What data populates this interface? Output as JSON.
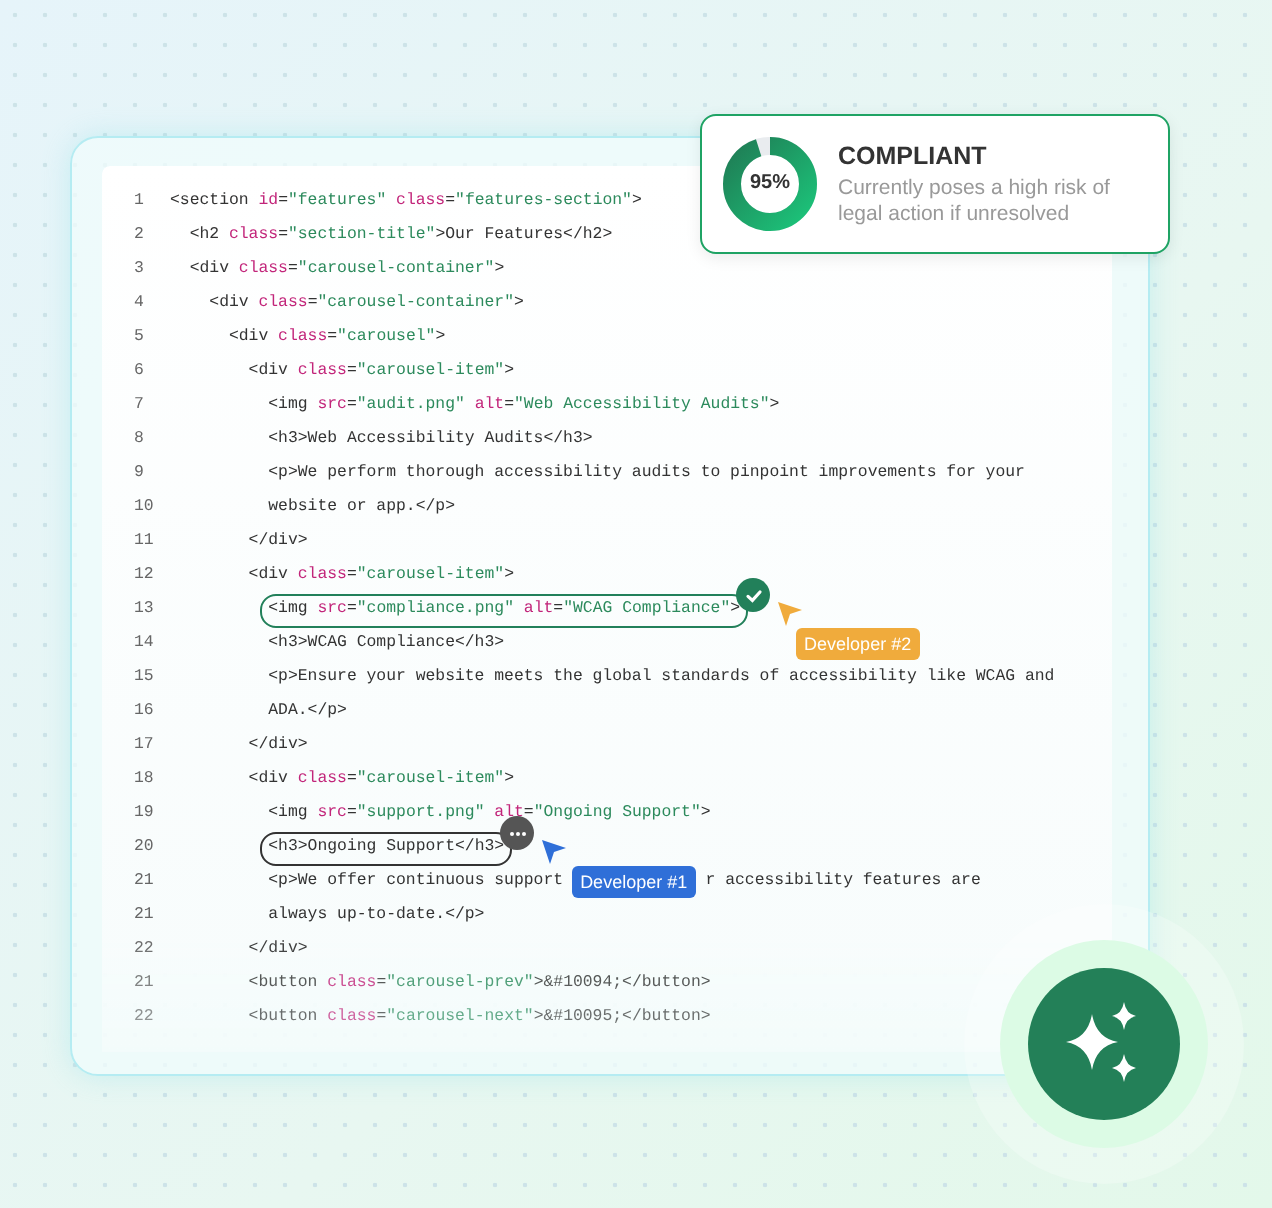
{
  "status_card": {
    "level": 0.95,
    "percent": "95%",
    "title": "COMPLIANT",
    "description": "Currently poses a high risk of legal action if unresolved"
  },
  "code_lines": [
    {
      "number": "1",
      "tokens": [
        {
          "kind": "tag",
          "text": "<section "
        },
        {
          "kind": "attr",
          "text": "id"
        },
        {
          "kind": "tag",
          "text": "="
        },
        {
          "kind": "str",
          "text": "\"features\" "
        },
        {
          "kind": "attr",
          "text": "class"
        },
        {
          "kind": "tag",
          "text": "="
        },
        {
          "kind": "str",
          "text": "\"features-section\""
        },
        {
          "kind": "tag",
          "text": ">"
        }
      ]
    },
    {
      "number": "2",
      "tokens": [
        {
          "kind": "tag",
          "text": "  <h2 "
        },
        {
          "kind": "attr",
          "text": "class"
        },
        {
          "kind": "tag",
          "text": "="
        },
        {
          "kind": "str",
          "text": "\"section-title\""
        },
        {
          "kind": "tag",
          "text": ">Our Features</h2>"
        }
      ]
    },
    {
      "number": "3",
      "tokens": [
        {
          "kind": "tag",
          "text": "  <div "
        },
        {
          "kind": "attr",
          "text": "class"
        },
        {
          "kind": "tag",
          "text": "="
        },
        {
          "kind": "str",
          "text": "\"carousel-container\""
        },
        {
          "kind": "tag",
          "text": ">"
        }
      ]
    },
    {
      "number": "4",
      "tokens": [
        {
          "kind": "tag",
          "text": "    <div "
        },
        {
          "kind": "attr",
          "text": "class"
        },
        {
          "kind": "tag",
          "text": "="
        },
        {
          "kind": "str",
          "text": "\"carousel-container\""
        },
        {
          "kind": "tag",
          "text": ">"
        }
      ]
    },
    {
      "number": "5",
      "tokens": [
        {
          "kind": "tag",
          "text": "      <div "
        },
        {
          "kind": "attr",
          "text": "class"
        },
        {
          "kind": "tag",
          "text": "="
        },
        {
          "kind": "str",
          "text": "\"carousel\""
        },
        {
          "kind": "tag",
          "text": ">"
        }
      ]
    },
    {
      "number": "6",
      "tokens": [
        {
          "kind": "tag",
          "text": "        <div "
        },
        {
          "kind": "attr",
          "text": "class"
        },
        {
          "kind": "tag",
          "text": "="
        },
        {
          "kind": "str",
          "text": "\"carousel-item\""
        },
        {
          "kind": "tag",
          "text": ">"
        }
      ]
    },
    {
      "number": "7",
      "tokens": [
        {
          "kind": "tag",
          "text": "          <img "
        },
        {
          "kind": "attr",
          "text": "src"
        },
        {
          "kind": "tag",
          "text": "="
        },
        {
          "kind": "str",
          "text": "\"audit.png\" "
        },
        {
          "kind": "attr",
          "text": "alt"
        },
        {
          "kind": "tag",
          "text": "="
        },
        {
          "kind": "str",
          "text": "\"Web Accessibility Audits\""
        },
        {
          "kind": "tag",
          "text": ">"
        }
      ]
    },
    {
      "number": "8",
      "tokens": [
        {
          "kind": "tag",
          "text": "          <h3>Web Accessibility Audits</h3>"
        }
      ]
    },
    {
      "number": "9",
      "tokens": [
        {
          "kind": "tag",
          "text": "          <p>We perform thorough accessibility audits to pinpoint improvements for your"
        }
      ]
    },
    {
      "number": "10",
      "tokens": [
        {
          "kind": "tag",
          "text": "          website or app.</p>"
        }
      ]
    },
    {
      "number": "11",
      "tokens": [
        {
          "kind": "tag",
          "text": "        </div>"
        }
      ]
    },
    {
      "number": "12",
      "tokens": [
        {
          "kind": "tag",
          "text": "        <div "
        },
        {
          "kind": "attr",
          "text": "class"
        },
        {
          "kind": "tag",
          "text": "="
        },
        {
          "kind": "str",
          "text": "\"carousel-item\""
        },
        {
          "kind": "tag",
          "text": ">"
        }
      ]
    },
    {
      "number": "13",
      "annotation": {
        "kind": "approved",
        "developer": "Developer #2",
        "color": "#f0ab3c"
      },
      "tokens": [
        {
          "kind": "tag",
          "text": "          <img "
        },
        {
          "kind": "attr",
          "text": "src"
        },
        {
          "kind": "tag",
          "text": "="
        },
        {
          "kind": "str",
          "text": "\"compliance.png\" "
        },
        {
          "kind": "attr",
          "text": "alt"
        },
        {
          "kind": "tag",
          "text": "="
        },
        {
          "kind": "str",
          "text": "\"WCAG Compliance\""
        },
        {
          "kind": "tag",
          "text": ">"
        }
      ]
    },
    {
      "number": "14",
      "tokens": [
        {
          "kind": "tag",
          "text": "          <h3>WCAG Compliance</h3>"
        }
      ]
    },
    {
      "number": "15",
      "tokens": [
        {
          "kind": "tag",
          "text": "          <p>Ensure your website meets the global standards of accessibility like WCAG and"
        }
      ]
    },
    {
      "number": "16",
      "tokens": [
        {
          "kind": "tag",
          "text": "          ADA.</p>"
        }
      ]
    },
    {
      "number": "17",
      "tokens": [
        {
          "kind": "tag",
          "text": "        </div>"
        }
      ]
    },
    {
      "number": "18",
      "tokens": [
        {
          "kind": "tag",
          "text": "        <div "
        },
        {
          "kind": "attr",
          "text": "class"
        },
        {
          "kind": "tag",
          "text": "="
        },
        {
          "kind": "str",
          "text": "\"carousel-item\""
        },
        {
          "kind": "tag",
          "text": ">"
        }
      ]
    },
    {
      "number": "19",
      "tokens": [
        {
          "kind": "tag",
          "text": "          <img "
        },
        {
          "kind": "attr",
          "text": "src"
        },
        {
          "kind": "tag",
          "text": "="
        },
        {
          "kind": "str",
          "text": "\"support.png\" "
        },
        {
          "kind": "attr",
          "text": "alt"
        },
        {
          "kind": "tag",
          "text": "="
        },
        {
          "kind": "str",
          "text": "\"Ongoing Support\""
        },
        {
          "kind": "tag",
          "text": ">"
        }
      ]
    },
    {
      "number": "20",
      "annotation": {
        "kind": "comment",
        "developer": "Developer #1",
        "color": "#2f6fd8"
      },
      "tokens": [
        {
          "kind": "tag",
          "text": "          <h3>Ongoing Support</h3>"
        }
      ]
    },
    {
      "number": "21",
      "tokens": [
        {
          "kind": "tag",
          "text": "          <p>We offer continuous support"
        },
        {
          "kind": "gap"
        },
        {
          "kind": "tag",
          "text": "r accessibility features are"
        }
      ]
    },
    {
      "number": "21",
      "tokens": [
        {
          "kind": "tag",
          "text": "          always up-to-date.</p>"
        }
      ]
    },
    {
      "number": "22",
      "tokens": [
        {
          "kind": "tag",
          "text": "        </div>"
        }
      ]
    },
    {
      "number": "21",
      "tokens": [
        {
          "kind": "tag",
          "text": "        <button "
        },
        {
          "kind": "attr",
          "text": "class"
        },
        {
          "kind": "tag",
          "text": "="
        },
        {
          "kind": "str",
          "text": "\"carousel-prev\""
        },
        {
          "kind": "tag",
          "text": ">&#10094;</button>"
        }
      ]
    },
    {
      "number": "22",
      "tokens": [
        {
          "kind": "tag",
          "text": "        <button "
        },
        {
          "kind": "attr",
          "text": "class"
        },
        {
          "kind": "tag",
          "text": "="
        },
        {
          "kind": "str",
          "text": "\"carousel-next\""
        },
        {
          "kind": "tag",
          "text": ">&#10095;</button>"
        }
      ]
    }
  ]
}
